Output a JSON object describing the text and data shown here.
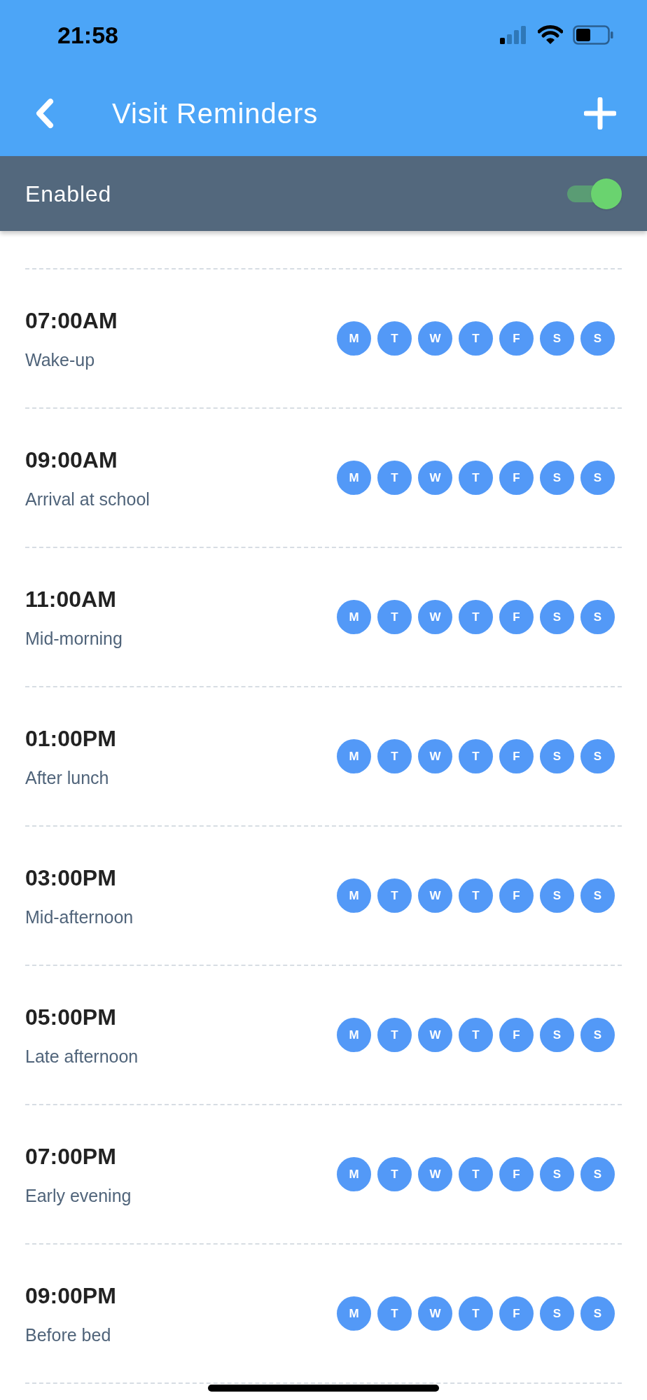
{
  "status_bar": {
    "time": "21:58"
  },
  "header": {
    "title": "Visit Reminders"
  },
  "enabled_bar": {
    "label": "Enabled",
    "on": true
  },
  "reminders": [
    {
      "time": "07:00AM",
      "label": "Wake-up",
      "days": [
        {
          "letter": "M",
          "selected": true
        },
        {
          "letter": "T",
          "selected": true
        },
        {
          "letter": "W",
          "selected": true
        },
        {
          "letter": "T",
          "selected": true
        },
        {
          "letter": "F",
          "selected": true
        },
        {
          "letter": "S",
          "selected": true
        },
        {
          "letter": "S",
          "selected": true
        }
      ]
    },
    {
      "time": "09:00AM",
      "label": "Arrival at school",
      "days": [
        {
          "letter": "M",
          "selected": true
        },
        {
          "letter": "T",
          "selected": true
        },
        {
          "letter": "W",
          "selected": true
        },
        {
          "letter": "T",
          "selected": true
        },
        {
          "letter": "F",
          "selected": true
        },
        {
          "letter": "S",
          "selected": true
        },
        {
          "letter": "S",
          "selected": true
        }
      ]
    },
    {
      "time": "11:00AM",
      "label": "Mid-morning",
      "days": [
        {
          "letter": "M",
          "selected": true
        },
        {
          "letter": "T",
          "selected": true
        },
        {
          "letter": "W",
          "selected": true
        },
        {
          "letter": "T",
          "selected": true
        },
        {
          "letter": "F",
          "selected": true
        },
        {
          "letter": "S",
          "selected": true
        },
        {
          "letter": "S",
          "selected": true
        }
      ]
    },
    {
      "time": "01:00PM",
      "label": "After lunch",
      "days": [
        {
          "letter": "M",
          "selected": true
        },
        {
          "letter": "T",
          "selected": true
        },
        {
          "letter": "W",
          "selected": true
        },
        {
          "letter": "T",
          "selected": true
        },
        {
          "letter": "F",
          "selected": true
        },
        {
          "letter": "S",
          "selected": true
        },
        {
          "letter": "S",
          "selected": true
        }
      ]
    },
    {
      "time": "03:00PM",
      "label": "Mid-afternoon",
      "days": [
        {
          "letter": "M",
          "selected": true
        },
        {
          "letter": "T",
          "selected": true
        },
        {
          "letter": "W",
          "selected": true
        },
        {
          "letter": "T",
          "selected": true
        },
        {
          "letter": "F",
          "selected": true
        },
        {
          "letter": "S",
          "selected": true
        },
        {
          "letter": "S",
          "selected": true
        }
      ]
    },
    {
      "time": "05:00PM",
      "label": "Late afternoon",
      "days": [
        {
          "letter": "M",
          "selected": true
        },
        {
          "letter": "T",
          "selected": true
        },
        {
          "letter": "W",
          "selected": true
        },
        {
          "letter": "T",
          "selected": true
        },
        {
          "letter": "F",
          "selected": true
        },
        {
          "letter": "S",
          "selected": true
        },
        {
          "letter": "S",
          "selected": true
        }
      ]
    },
    {
      "time": "07:00PM",
      "label": "Early evening",
      "days": [
        {
          "letter": "M",
          "selected": true
        },
        {
          "letter": "T",
          "selected": true
        },
        {
          "letter": "W",
          "selected": true
        },
        {
          "letter": "T",
          "selected": true
        },
        {
          "letter": "F",
          "selected": true
        },
        {
          "letter": "S",
          "selected": true
        },
        {
          "letter": "S",
          "selected": true
        }
      ]
    },
    {
      "time": "09:00PM",
      "label": "Before bed",
      "days": [
        {
          "letter": "M",
          "selected": true
        },
        {
          "letter": "T",
          "selected": true
        },
        {
          "letter": "W",
          "selected": true
        },
        {
          "letter": "T",
          "selected": true
        },
        {
          "letter": "F",
          "selected": true
        },
        {
          "letter": "S",
          "selected": true
        },
        {
          "letter": "S",
          "selected": true
        }
      ]
    }
  ]
}
